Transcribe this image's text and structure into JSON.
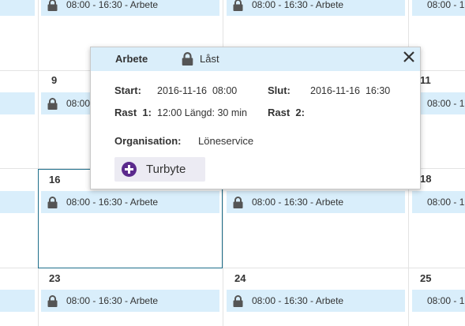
{
  "calendar": {
    "event_label": "08:00 - 16:30 - Arbete",
    "days": {
      "d9": "9",
      "d11": "11",
      "d16": "16",
      "d18": "18",
      "d23": "23",
      "d24": "24",
      "d25": "25"
    },
    "colors": {
      "event_bg": "#d9eefb",
      "selected_border": "#1f6f8b"
    }
  },
  "popup": {
    "title": "Arbete",
    "lock_icon": "lock-icon",
    "status": "Låst",
    "close_icon": "close-icon",
    "start_label": "Start:",
    "start_value": "2016-11-16  08:00",
    "end_label": "Slut:",
    "end_value": "2016-11-16  16:30",
    "rast1_label": "Rast  1:",
    "rast1_value": "12:00 Längd: 30 min",
    "rast2_label": "Rast  2:",
    "org_label": "Organisation:",
    "org_value": "Löneservice",
    "turbyte_label": "Turbyte",
    "turbyte_icon": "plus-circle-icon",
    "colors": {
      "header_bg": "#daeefa",
      "button_bg": "#ecebf3",
      "plus_color": "#5b2a8c"
    }
  }
}
